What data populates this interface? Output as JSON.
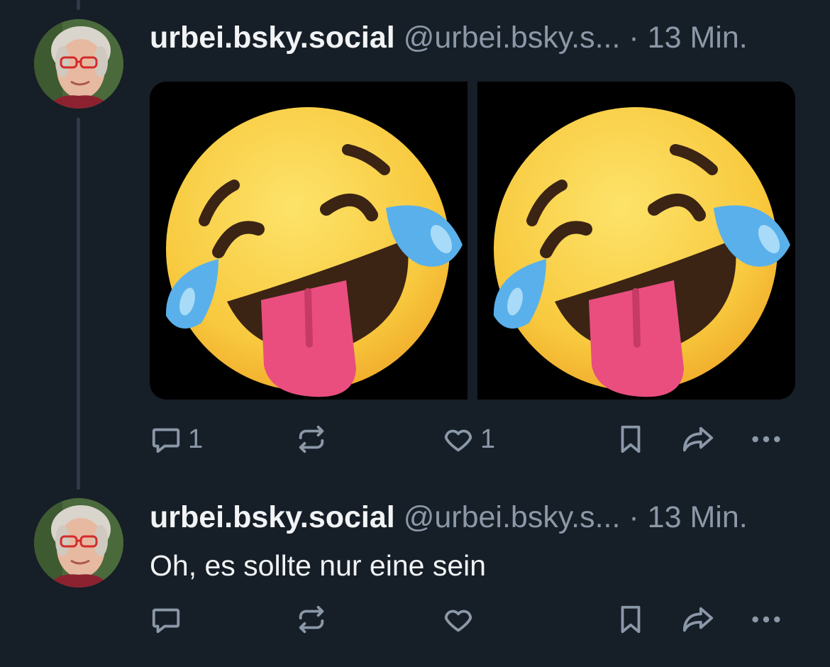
{
  "posts": [
    {
      "display_name": "urbei.bsky.social",
      "handle": "@urbei.bsky.s...",
      "separator": "·",
      "time": "13 Min.",
      "text": "",
      "images": [
        {
          "alt_icon": "rolling-on-the-floor-laughing-emoji"
        },
        {
          "alt_icon": "rolling-on-the-floor-laughing-emoji"
        }
      ],
      "reply_count": "1",
      "repost_count": "",
      "like_count": "1"
    },
    {
      "display_name": "urbei.bsky.social",
      "handle": "@urbei.bsky.s...",
      "separator": "·",
      "time": "13 Min.",
      "text": "Oh, es sollte nur eine sein",
      "reply_count": "",
      "repost_count": "",
      "like_count": ""
    }
  ],
  "colors": {
    "background": "#161e27",
    "text": "#f1f3f5",
    "muted": "#8b98a8",
    "thread_line": "#2e3a4a"
  }
}
